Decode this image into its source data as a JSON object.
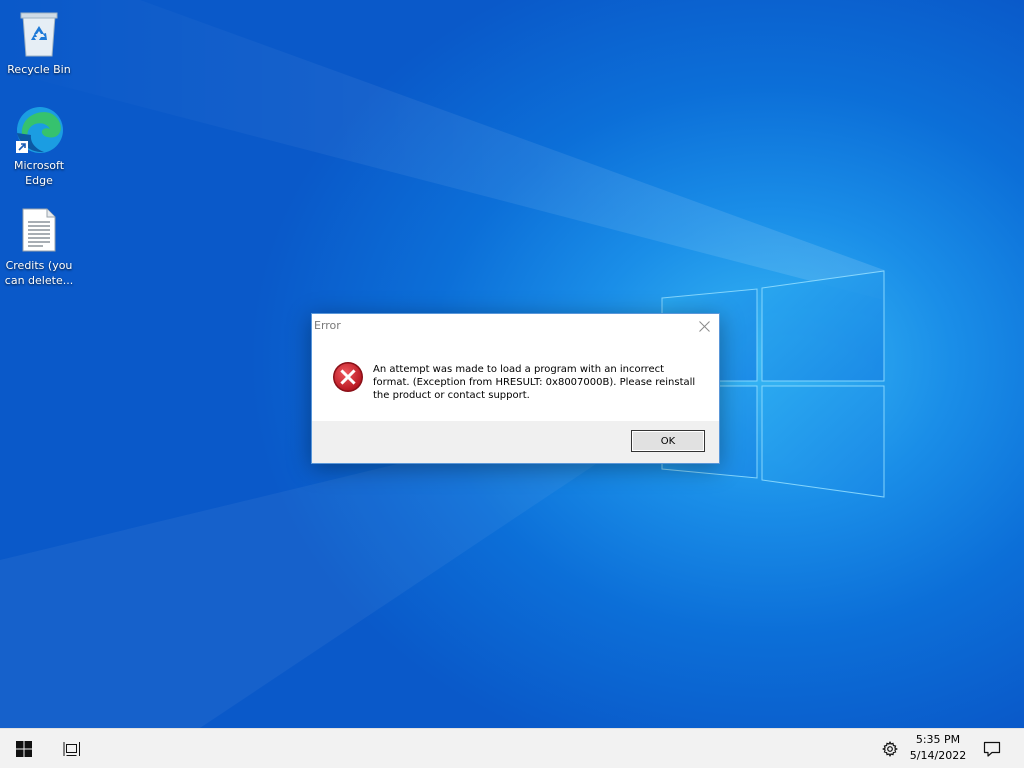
{
  "desktop": {
    "icons": [
      {
        "label": "Recycle Bin",
        "icon": "recycle-bin-icon"
      },
      {
        "label": "Microsoft\nEdge",
        "icon": "edge-icon"
      },
      {
        "label": "Credits (you\ncan delete...",
        "icon": "text-document-icon"
      }
    ]
  },
  "dialog": {
    "title": "Error",
    "message": "An attempt was made to load a program with an incorrect format. (Exception from HRESULT: 0x8007000B). Please reinstall the product or contact support.",
    "ok_label": "OK",
    "icon": "error-icon",
    "close_icon": "close-icon"
  },
  "taskbar": {
    "start_icon": "windows-start-icon",
    "task_view_icon": "task-view-icon",
    "settings_icon": "gear-icon",
    "time": "5:35 PM",
    "date": "5/14/2022",
    "notifications_icon": "action-center-icon"
  },
  "colors": {
    "wallpaper": "#0a59c9",
    "accent": "#1a8ee8",
    "error_red": "#d3232b",
    "taskbar": "#f2f2f2"
  }
}
